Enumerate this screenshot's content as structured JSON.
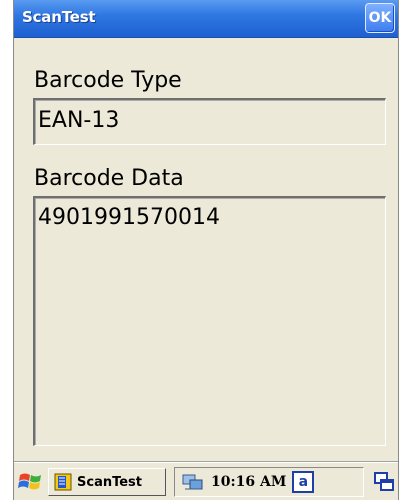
{
  "window": {
    "title": "ScanTest",
    "ok_label": "OK"
  },
  "form": {
    "barcode_type_label": "Barcode Type",
    "barcode_type_value": "EAN-13",
    "barcode_data_label": "Barcode Data",
    "barcode_data_value": "4901991570014"
  },
  "taskbar": {
    "start_icon": "windows-flag-icon",
    "task_label": "ScanTest",
    "task_icon": "app-icon",
    "network_icon": "network-icon",
    "clock": "10:16 AM",
    "ime_label": "a",
    "switch_icon": "windows-switch-icon"
  }
}
